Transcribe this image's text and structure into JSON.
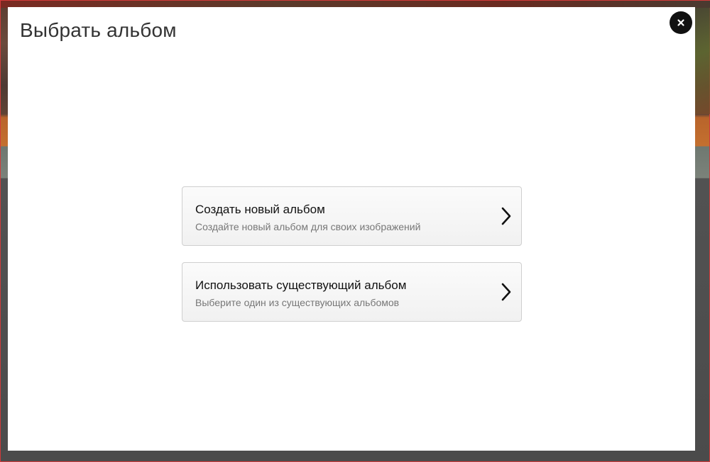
{
  "modal": {
    "title": "Выбрать альбом",
    "close_icon": "close-icon"
  },
  "options": [
    {
      "title": "Создать новый альбом",
      "subtitle": "Создайте новый альбом для своих изображений",
      "icon": "chevron-right-icon"
    },
    {
      "title": "Использовать существующий альбом",
      "subtitle": "Выберите один из существующих альбомов",
      "icon": "chevron-right-icon"
    }
  ],
  "colors": {
    "close_button_bg": "#111111",
    "card_border": "#cfcfcf",
    "subtitle_text": "#777777"
  }
}
